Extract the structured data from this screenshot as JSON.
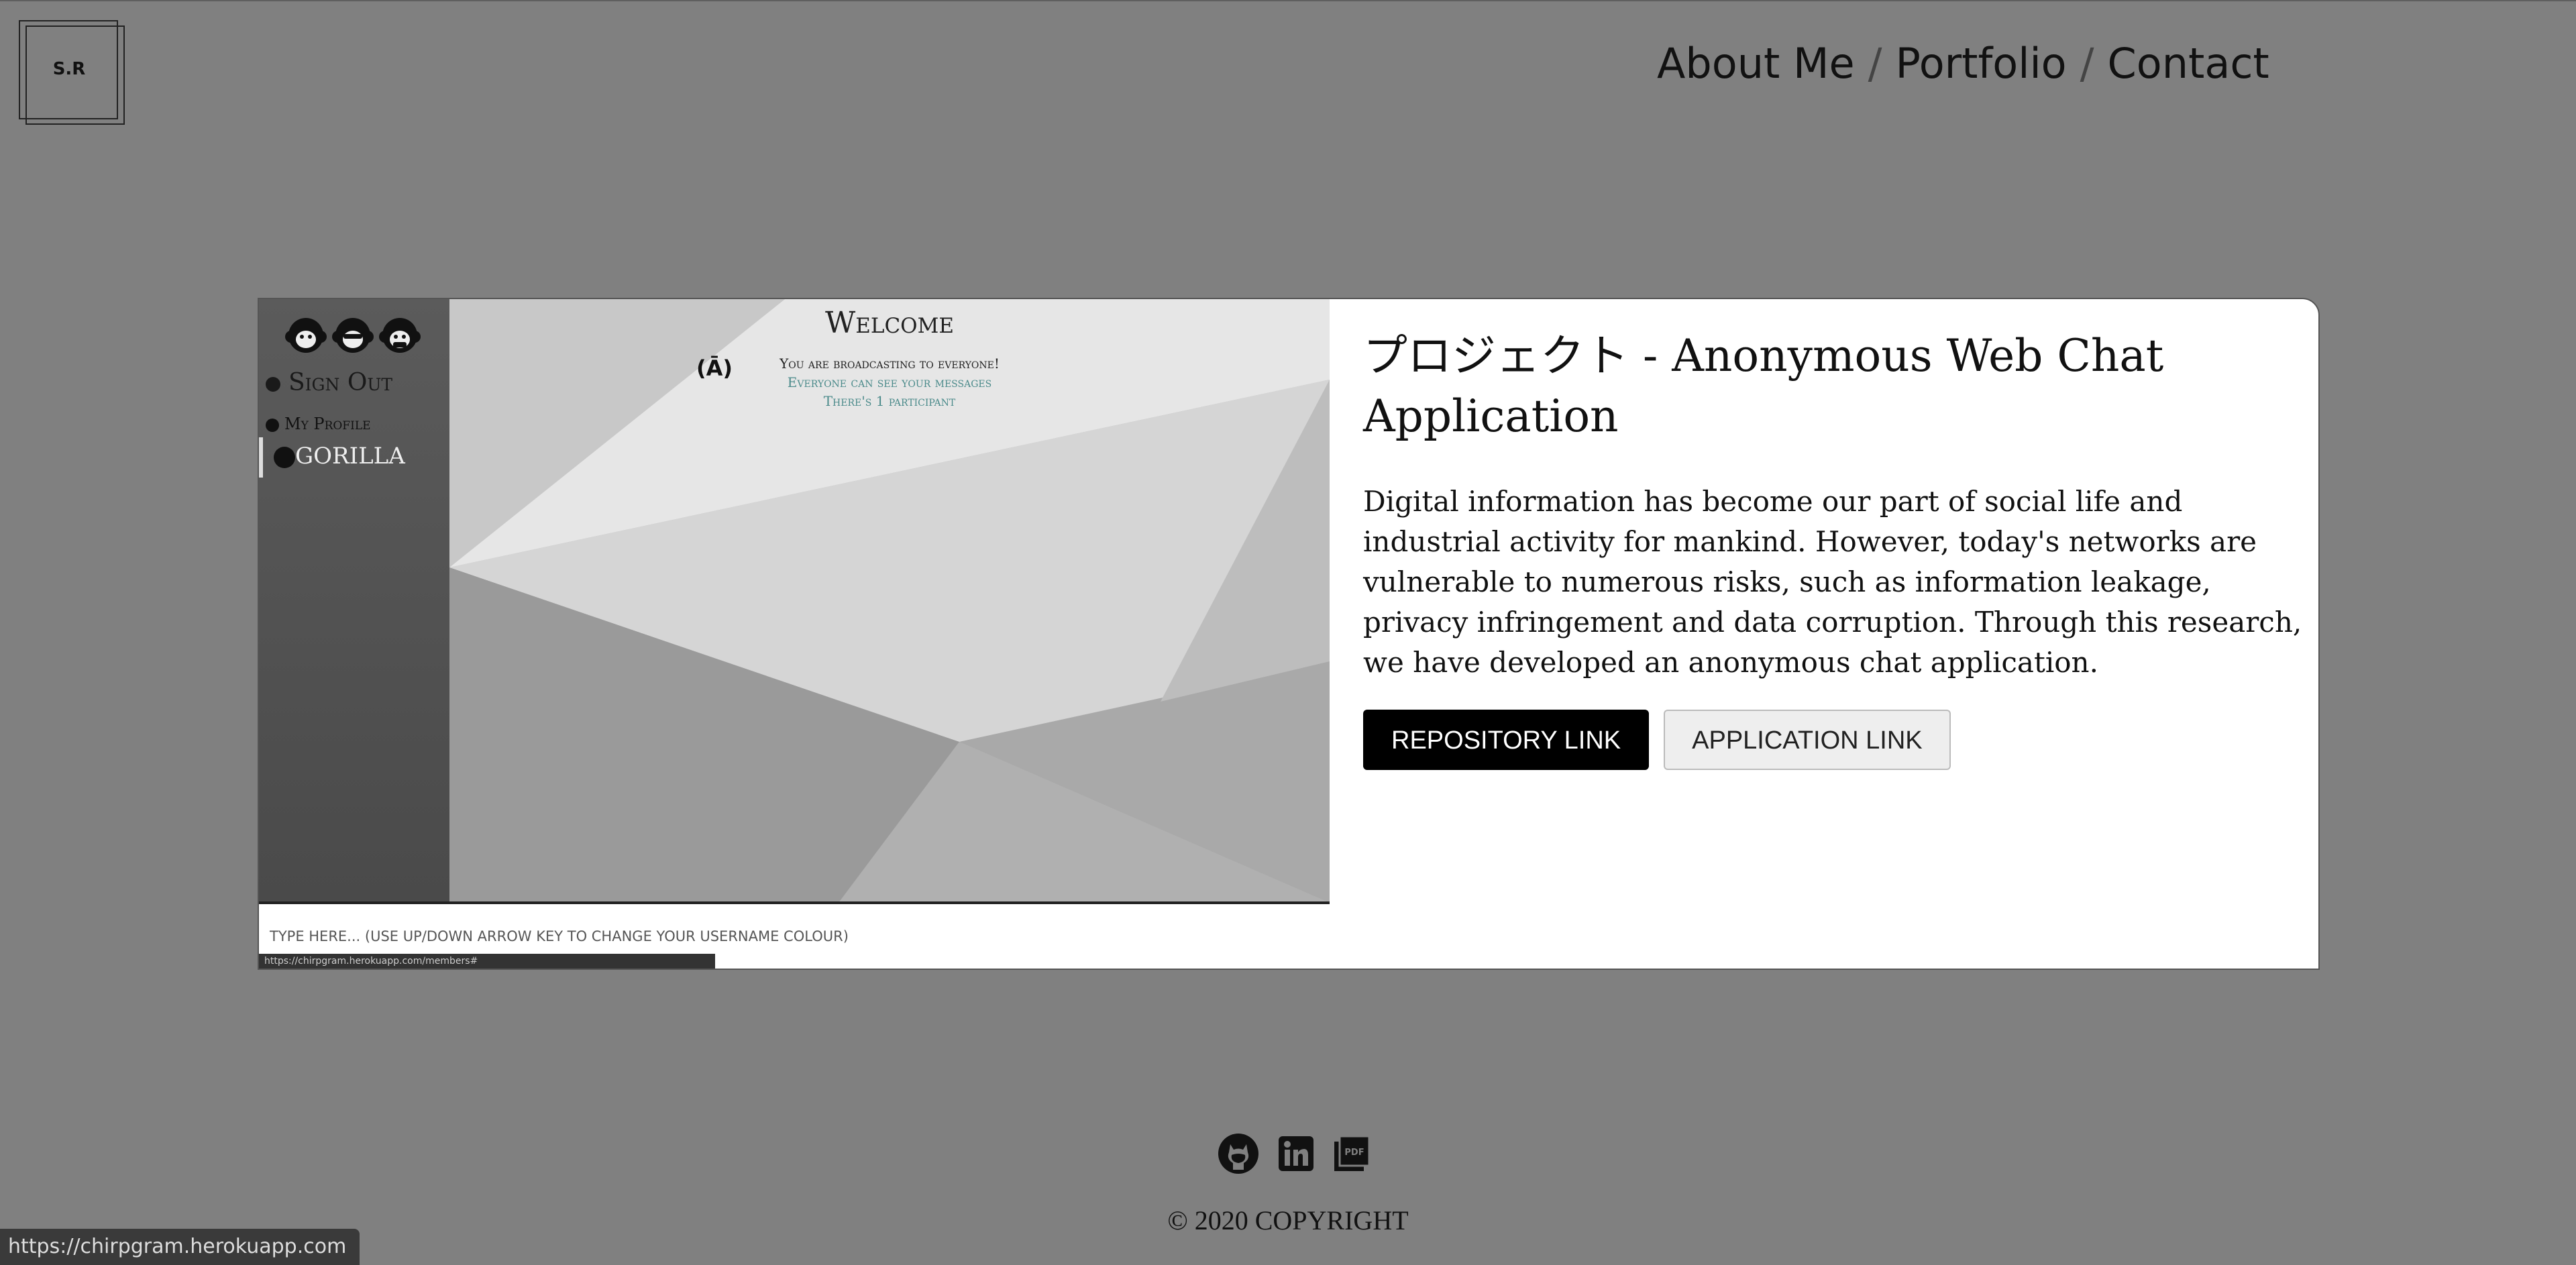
{
  "logo": {
    "text": "S.R"
  },
  "nav": {
    "about": "About Me",
    "portfolio": "Portfolio",
    "contact": "Contact",
    "separator": "/"
  },
  "project": {
    "title": "プロジェクト - Anonymous Web Chat Application",
    "description": "Digital information has become our part of social life and industrial activity for mankind. However, today's networks are vulnerable to numerous risks, such as information leakage, privacy infringement and data corruption. Through this research, we have developed an anonymous chat application.",
    "repo_button": "REPOSITORY LINK",
    "app_button": "APPLICATION LINK"
  },
  "preview": {
    "sign_out": "Sign Out",
    "my_profile": "My Profile",
    "user": "GORILLA",
    "welcome": "Welcome",
    "broadcast_line1": "You are broadcasting to everyone!",
    "broadcast_line2": "Everyone can see your messages",
    "broadcast_line3": "There's 1 participant",
    "input_placeholder": "TYPE HERE... (USE UP/DOWN ARROW KEY TO CHANGE YOUR USERNAME COLOUR)",
    "status_url": "https://chirpgram.herokuapp.com/members#"
  },
  "footer": {
    "icons": [
      "github-icon",
      "linkedin-icon",
      "pdf-icon"
    ],
    "copyright": "© 2020 COPYRIGHT"
  },
  "statusbar": {
    "url": "https://chirpgram.herokuapp.com"
  },
  "colors": {
    "page_bg": "#808080",
    "card_bg": "#ffffff",
    "primary_button": "#000000",
    "accent_teal": "#4a8a8a"
  }
}
